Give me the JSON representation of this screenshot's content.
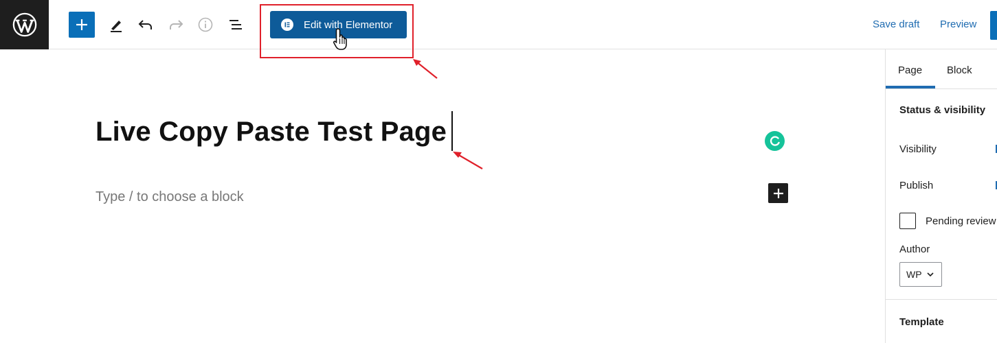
{
  "toolbar": {
    "elementor_label": "Edit with Elementor",
    "save_draft_label": "Save draft",
    "preview_label": "Preview"
  },
  "editor": {
    "title": "Live Copy Paste Test Page",
    "block_placeholder": "Type / to choose a block"
  },
  "sidebar": {
    "tabs": [
      "Page",
      "Block"
    ],
    "active_tab": "Page",
    "section_heading": "Status & visibility",
    "visibility_label": "Visibility",
    "publish_label": "Publish",
    "pending_review_label": "Pending review",
    "author_label": "Author",
    "author_value": "WP",
    "template_heading": "Template"
  },
  "colors": {
    "accent": "#0a6fb8",
    "elementor": "#0e5b99",
    "annotation": "#e0202a",
    "grammarly": "#15c39a"
  },
  "icons": [
    "wordpress-logo-icon",
    "plus-icon",
    "pencil-icon",
    "undo-icon",
    "redo-icon",
    "info-icon",
    "list-view-icon",
    "elementor-icon",
    "hand-cursor-icon",
    "grammarly-icon",
    "chevron-down-icon"
  ]
}
